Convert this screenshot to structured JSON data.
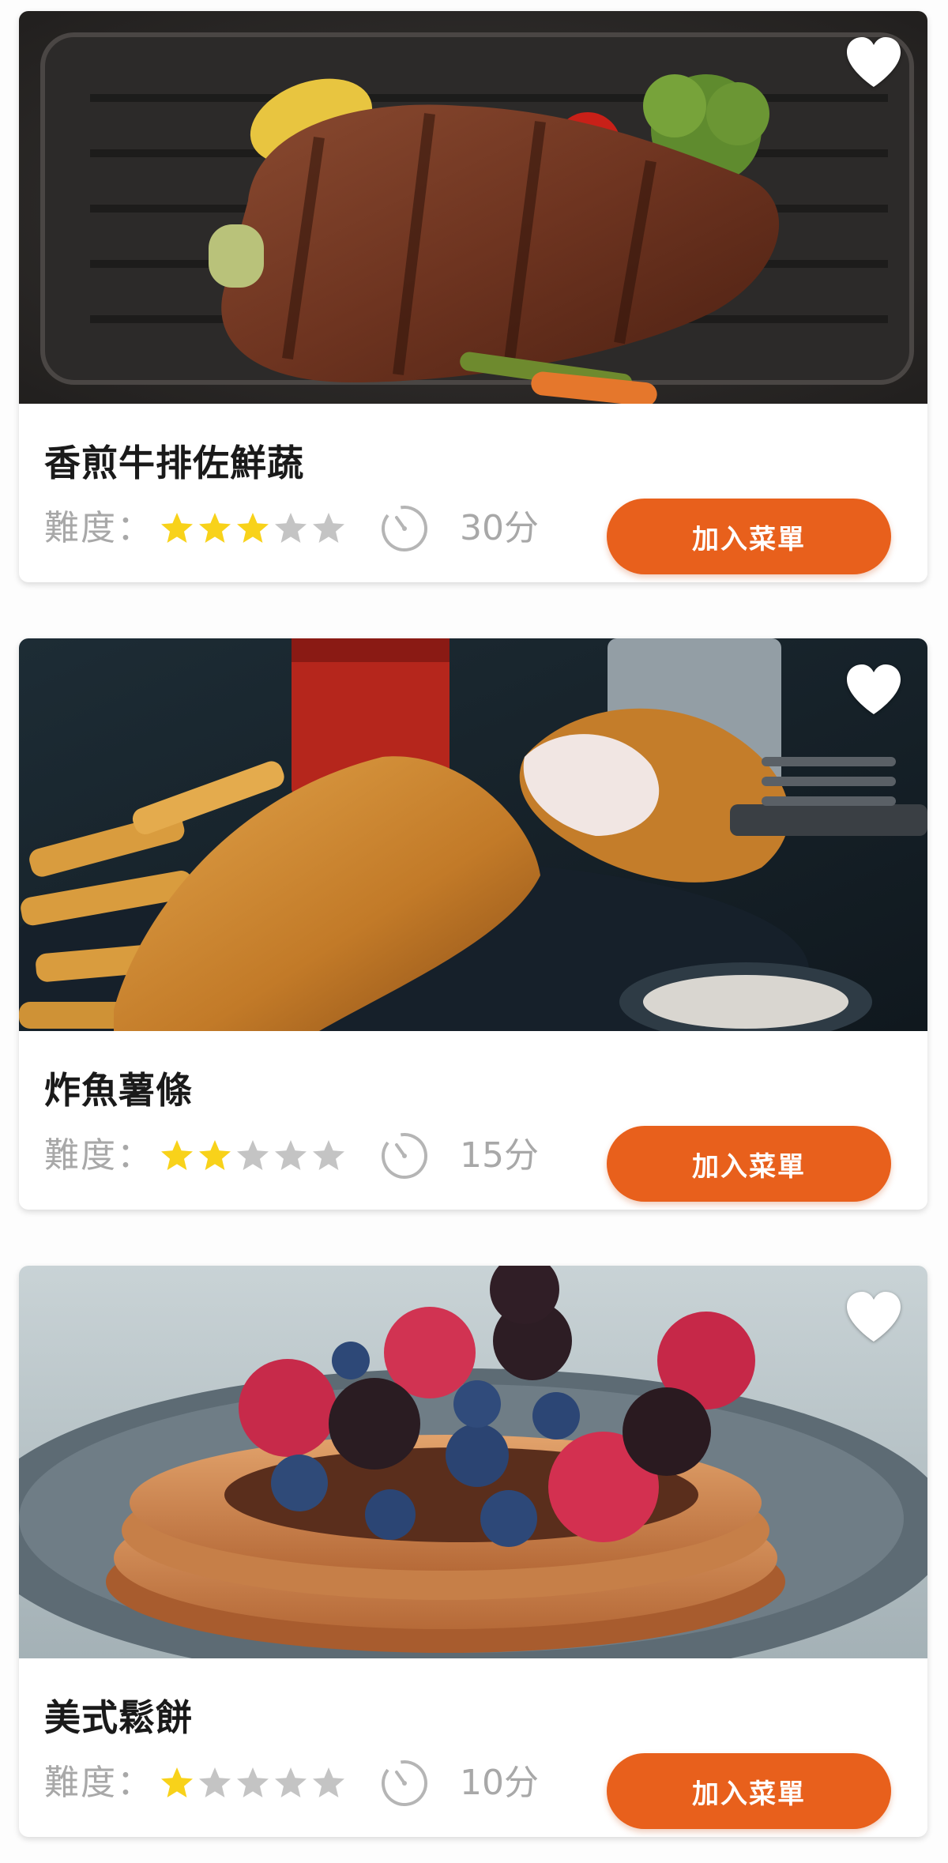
{
  "labels": {
    "difficulty": "難度：",
    "add_button": "加入菜單"
  },
  "icons": {
    "favorite": "heart-icon",
    "star": "star-icon",
    "timer": "timer-icon"
  },
  "colors": {
    "accent": "#e8601c",
    "star_on": "#f8d21a",
    "star_off": "#c4c4c4",
    "muted_text": "#a8a8a8"
  },
  "recipes": [
    {
      "title": "香煎牛排佐鮮蔬",
      "difficulty": 3,
      "difficulty_max": 5,
      "time": "30分",
      "image": "steak-photo"
    },
    {
      "title": "炸魚薯條",
      "difficulty": 2,
      "difficulty_max": 5,
      "time": "15分",
      "image": "fish-and-chips-photo"
    },
    {
      "title": "美式鬆餅",
      "difficulty": 1,
      "difficulty_max": 5,
      "time": "10分",
      "image": "pancakes-photo"
    }
  ]
}
